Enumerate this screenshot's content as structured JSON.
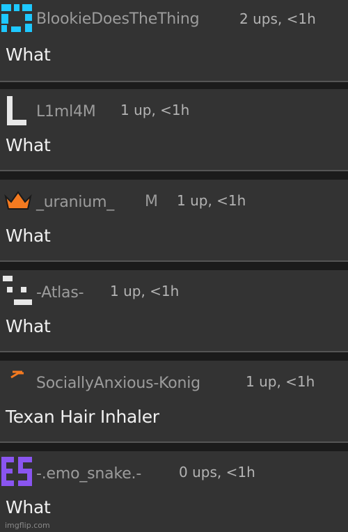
{
  "comments": [
    {
      "username": "BlookieDoesTheThing",
      "stats": "2 ups, <1h",
      "text": "What",
      "avatar_icon": "blue-pixel-icon"
    },
    {
      "username": "L1ml4M",
      "stats": "1 up, <1h",
      "text": "What",
      "avatar_icon": "letter-l-icon"
    },
    {
      "username": "_uranium_",
      "badge": "M",
      "stats": "1 up, <1h",
      "text": "What",
      "avatar_icon": "crown-icon"
    },
    {
      "username": "-Atlas-",
      "stats": "1 up, <1h",
      "text": "What",
      "avatar_icon": "pixel-face-icon"
    },
    {
      "username": "SociallyAnxious-Konig",
      "stats": "1 up, <1h",
      "text": "Texan Hair Inhaler",
      "avatar_icon": "orange-squiggle-icon"
    },
    {
      "username": "-.emo_snake.-",
      "stats": "0 ups, <1h",
      "text": "What",
      "avatar_icon": "purple-es-icon"
    }
  ],
  "watermark": "imgflip.com",
  "colors": {
    "background": "#333333",
    "separator": "#1b1b1b",
    "username": "#9c9c9c",
    "text": "#f0f0f0",
    "crown": "#f47a20",
    "blue_avatar": "#1ec8ff",
    "purple_avatar": "#8a55f0"
  }
}
